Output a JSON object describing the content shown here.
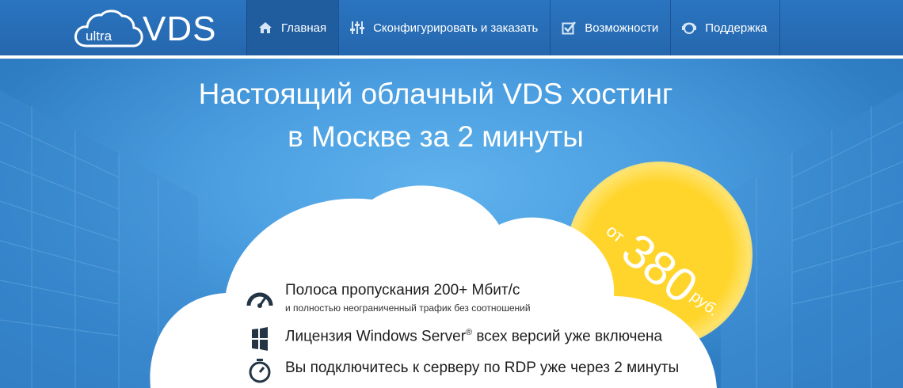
{
  "logo": {
    "ultra": "ultra",
    "vds": "VDS"
  },
  "nav": [
    {
      "label": "Главная",
      "icon": "home-icon",
      "active": true
    },
    {
      "label": "Сконфигурировать и заказать",
      "icon": "sliders-icon",
      "active": false
    },
    {
      "label": "Возможности",
      "icon": "checkbox-icon",
      "active": false
    },
    {
      "label": "Поддержка",
      "icon": "support-icon",
      "active": false
    }
  ],
  "hero": {
    "headline_line1": "Настоящий облачный VDS хостинг",
    "headline_line2": "в Москве за 2 минуты",
    "price": {
      "from": "от",
      "value": "380",
      "currency": "руб."
    }
  },
  "features": [
    {
      "icon": "speedometer-icon",
      "title": "Полоса пропускания 200+ Мбит/с",
      "subtitle": "и полностью неограниченный трафик без соотношений"
    },
    {
      "icon": "windows-icon",
      "title_pre": "Лицензия Windows Server",
      "title_sup": "®",
      "title_post": " всех версий уже включена"
    },
    {
      "icon": "stopwatch-icon",
      "title": "Вы подключитесь к серверу по RDP уже через 2 минуты"
    }
  ],
  "colors": {
    "header": "#2567ad",
    "hero": "#4b9fe1",
    "sun": "#ffd52b",
    "active_nav": "#1f5d9f"
  }
}
